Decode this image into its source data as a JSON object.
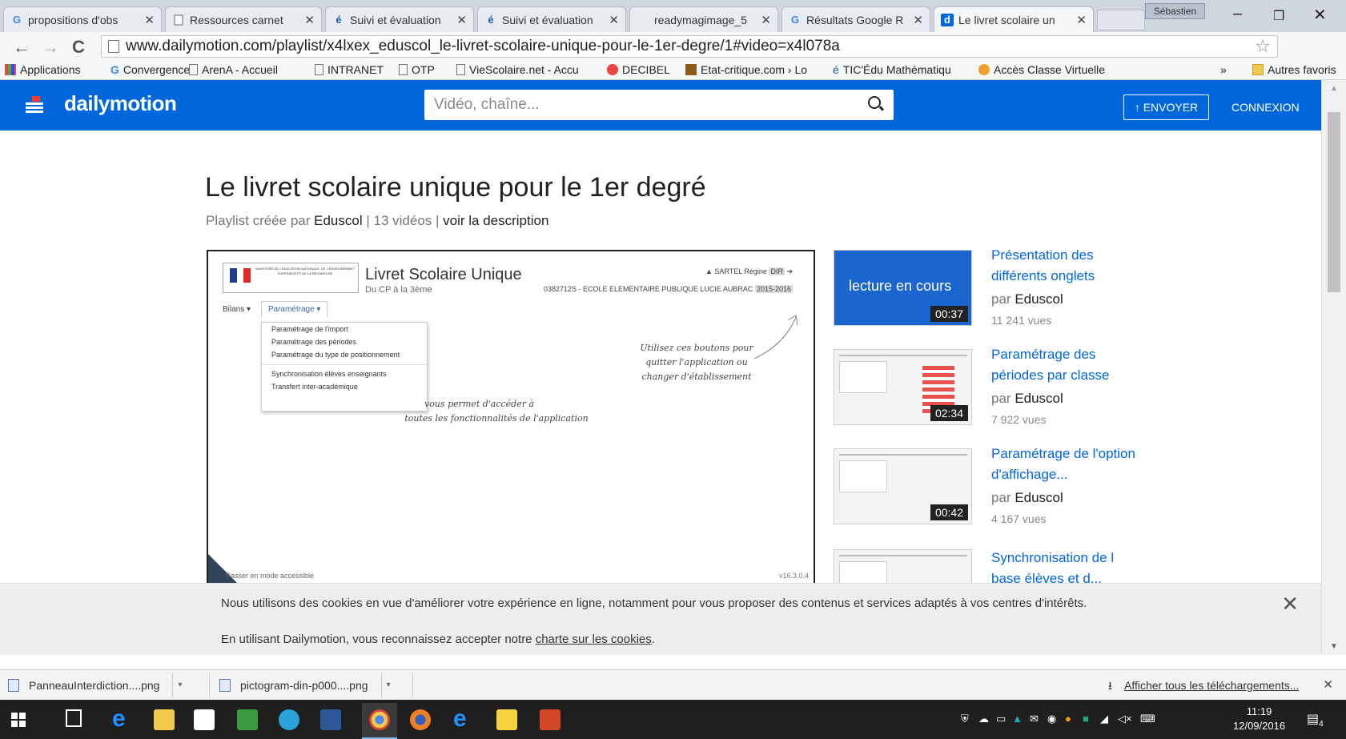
{
  "browser": {
    "tabs": [
      {
        "label": "propositions d'obs",
        "favicon": "G",
        "color": "#4285f4"
      },
      {
        "label": "Ressources carnet",
        "favicon": "page",
        "color": "#555"
      },
      {
        "label": "Suivi et évaluation",
        "favicon": "é",
        "color": "#1c5fa6"
      },
      {
        "label": "Suivi et évaluation",
        "favicon": "é",
        "color": "#1c5fa6"
      },
      {
        "label": "readymagimage_5",
        "favicon": "",
        "color": "#555"
      },
      {
        "label": "Résultats Google R",
        "favicon": "G",
        "color": "#4285f4"
      },
      {
        "label": "Le livret scolaire un",
        "favicon": "d",
        "color": "#0066dc"
      }
    ],
    "profile": "Sébastien",
    "url": "www.dailymotion.com/playlist/x4lxex_eduscol_le-livret-scolaire-unique-pour-le-1er-degre/1#video=x4l078a",
    "bookmarks": [
      {
        "label": "Applications",
        "icon": "apps-icon"
      },
      {
        "label": "Convergence",
        "icon": "google-icon"
      },
      {
        "label": "ArenA - Accueil",
        "icon": "page-icon"
      },
      {
        "label": "INTRANET",
        "icon": "page-icon"
      },
      {
        "label": "OTP",
        "icon": "page-icon"
      },
      {
        "label": "VieScolaire.net - Accu",
        "icon": "page-icon"
      },
      {
        "label": "DECIBEL",
        "icon": "decibel-icon"
      },
      {
        "label": "Etat-critique.com › Lo",
        "icon": "etat-icon"
      },
      {
        "label": "TIC'Édu Mathématiqu",
        "icon": "ticedu-icon"
      },
      {
        "label": "Accès Classe Virtuelle",
        "icon": "classe-icon"
      }
    ],
    "bookmarks_more": "»",
    "other_bookmarks": "Autres favoris"
  },
  "dm": {
    "logo": "dailymotion",
    "search_placeholder": "Vidéo, chaîne...",
    "upload_label": "↑ ENVOYER",
    "login_label": "CONNEXION"
  },
  "playlist": {
    "title": "Le livret scolaire unique pour le 1er degré",
    "created_by_prefix": "Playlist créée par",
    "owner": "Eduscol",
    "video_count": "13 vidéos",
    "description_link": "voir la description"
  },
  "player": {
    "app_title": "Livret Scolaire Unique",
    "app_sub": "Du CP à la 3ème",
    "ministry": "MINISTÈRE DE L'ÉDUCATION NATIONALE, DE L'ENSEIGNEMENT SUPÉRIEUR ET DE LA RECHERCHE",
    "user": "SARTEL Régine",
    "role": "DIR",
    "school": "0382712S - ECOLE ELEMENTAIRE PUBLIQUE LUCIE AUBRAC",
    "year": "2015-2016",
    "nav_bilans": "Bilans ▾",
    "nav_param": "Paramétrage ▾",
    "menu": [
      "Paramétrage de l'import",
      "Paramétrage des périodes",
      "Paramétrage du type de positionnement",
      "Synchronisation élèves enseignants",
      "Transfert inter-académique"
    ],
    "note_right_1": "Utilisez ces boutons pour",
    "note_right_2": "quitter l'application ou",
    "note_right_3": "changer d'établissement",
    "note_left_1": "vous permet d'accéder à",
    "note_left_2": "toutes les fonctionnalités de l'application",
    "accessible": "Passer en mode accessible",
    "version": "v16.3.0.4"
  },
  "videos": [
    {
      "title": "Présentation des différents onglets",
      "by": "par",
      "owner": "Eduscol",
      "views": "11 241 vues",
      "duration": "00:37",
      "playing": "lecture en cours"
    },
    {
      "title": "Paramétrage des périodes par classe",
      "by": "par",
      "owner": "Eduscol",
      "views": "7 922 vues",
      "duration": "02:34"
    },
    {
      "title": "Paramétrage de l'option d'affichage...",
      "by": "par",
      "owner": "Eduscol",
      "views": "4 167 vues",
      "duration": "00:42"
    },
    {
      "title": "Synchronisation de la base élèves et d...",
      "by": "",
      "owner": "",
      "views": "",
      "duration": ""
    }
  ],
  "cookie": {
    "line1": "Nous utilisons des cookies en vue d'améliorer votre expérience en ligne, notamment pour vous proposer des contenus et services adaptés à vos centres d'intérêts.",
    "line2_prefix": "En utilisant Dailymotion, vous reconnaissez accepter notre",
    "line2_link": "charte sur les cookies",
    "line2_suffix": "."
  },
  "downloads": {
    "items": [
      "PanneauInterdiction....png",
      "pictogram-din-p000....png"
    ],
    "show_all": "Afficher tous les téléchargements..."
  },
  "taskbar": {
    "time": "11:19",
    "date": "12/09/2016",
    "notifications": "4"
  }
}
